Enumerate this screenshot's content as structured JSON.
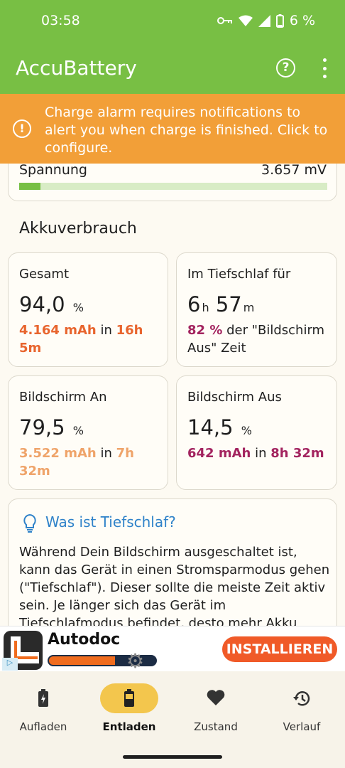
{
  "status": {
    "time": "03:58",
    "battery": "6 %"
  },
  "app": {
    "title": "AccuBattery"
  },
  "alert": {
    "text": "Charge alarm requires notifications to alert you when charge is finished. Click to configure."
  },
  "voltage": {
    "label": "Spannung",
    "value": "3.657 mV",
    "level": 0.07
  },
  "section": {
    "title": "Akkuverbrauch"
  },
  "stats": {
    "gesamt": {
      "label": "Gesamt",
      "value": "94,0",
      "unit": "%",
      "mah": "4.164 mAh",
      "in": "in",
      "duration": "16h 5m"
    },
    "tief": {
      "label": "Im Tiefschlaf für",
      "h": "6",
      "hunit": "h",
      "m": "57",
      "munit": "m",
      "pct": "82 %",
      "rest": "der \"Bildschirm Aus\" Zeit"
    },
    "an": {
      "label": "Bildschirm An",
      "value": "79,5",
      "unit": "%",
      "mah": "3.522 mAh",
      "in": "in",
      "duration": "7h 32m"
    },
    "aus": {
      "label": "Bildschirm Aus",
      "value": "14,5",
      "unit": "%",
      "mah": "642 mAh",
      "in": "in",
      "duration": "8h 32m"
    }
  },
  "info": {
    "question": "Was ist Tiefschlaf?",
    "body": "Während Dein Bildschirm ausgeschaltet ist, kann das Gerät in einen Stromsparmodus gehen (\"Tiefschlaf\"). Dieser sollte die meiste Zeit aktiv sein. Je länger sich das Gerät im Tiefschlafmodus befindet, desto mehr Akku"
  },
  "ad": {
    "name": "Autodoc",
    "cta": "INSTALLIEREN",
    "progress": 0.62
  },
  "nav": [
    {
      "label": "Aufladen",
      "icon": "battery-charging-icon"
    },
    {
      "label": "Entladen",
      "icon": "battery-discharging-icon"
    },
    {
      "label": "Zustand",
      "icon": "heart-icon"
    },
    {
      "label": "Verlauf",
      "icon": "history-icon"
    }
  ],
  "colors": {
    "green": "#78bf44",
    "orange": "#f29f38",
    "red": "#e8652e",
    "lightorange": "#efa46a",
    "purple": "#a3245f",
    "accent": "#f3c64d"
  }
}
